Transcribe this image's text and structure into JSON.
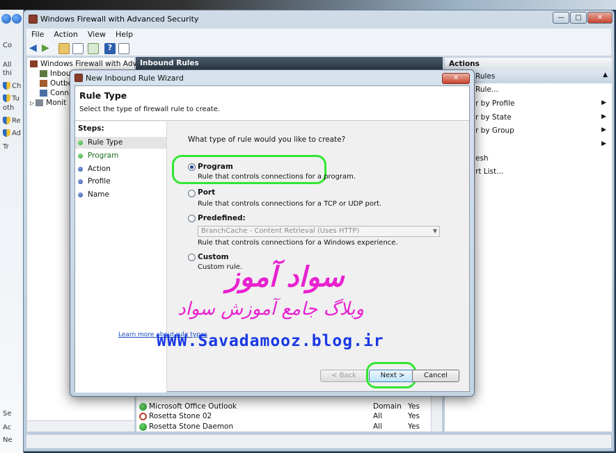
{
  "main_window": {
    "title": "Windows Firewall with Advanced Security",
    "controls": {
      "minimize": "—",
      "maximize": "□",
      "close": "✕"
    }
  },
  "menu": [
    "File",
    "Action",
    "View",
    "Help"
  ],
  "backdrop_left": [
    "Co",
    "All",
    "thi",
    "Ch",
    "Tu",
    "oth",
    "Re",
    "Ad",
    "Tr",
    "Se",
    "Ac",
    "Ne"
  ],
  "tree": {
    "root": "Windows Firewall with Advance",
    "items": [
      "Inboun",
      "Outbo",
      "Conne",
      "Monit"
    ]
  },
  "center": {
    "header": "Inbound Rules",
    "rows": [
      {
        "name": "Microsoft Office Outlook",
        "profile": "Domain",
        "enabled": "Yes",
        "status": "ok"
      },
      {
        "name": "Rosetta Stone 02",
        "profile": "All",
        "enabled": "Yes",
        "status": "no"
      },
      {
        "name": "Rosetta Stone Daemon",
        "profile": "All",
        "enabled": "Yes",
        "status": "ok"
      }
    ]
  },
  "actions": {
    "header": "Actions",
    "section": "Rules",
    "items": [
      {
        "label": "Rule...",
        "arrow": ""
      },
      {
        "label": "r by Profile",
        "arrow": "▶"
      },
      {
        "label": "r by State",
        "arrow": "▶"
      },
      {
        "label": "r by Group",
        "arrow": "▶"
      },
      {
        "label": "",
        "arrow": "▶"
      },
      {
        "label": "esh",
        "arrow": ""
      },
      {
        "label": "rt List...",
        "arrow": ""
      }
    ]
  },
  "wizard": {
    "title": "New Inbound Rule Wizard",
    "close": "✕",
    "heading": "Rule Type",
    "subheading": "Select the type of firewall rule to create.",
    "steps_title": "Steps:",
    "steps": [
      {
        "label": "Rule Type",
        "state": "active"
      },
      {
        "label": "Program",
        "state": "done"
      },
      {
        "label": "Action",
        "state": "pending"
      },
      {
        "label": "Profile",
        "state": "pending"
      },
      {
        "label": "Name",
        "state": "pending"
      }
    ],
    "question": "What type of rule would you like to create?",
    "options": [
      {
        "label": "Program",
        "desc": "Rule that controls connections for a program.",
        "checked": true
      },
      {
        "label": "Port",
        "desc": "Rule that controls connections for a TCP or UDP port.",
        "checked": false
      },
      {
        "label": "Predefined:",
        "desc": "Rule that controls connections for a Windows experience.",
        "checked": false
      },
      {
        "label": "Custom",
        "desc": "Custom rule.",
        "checked": false
      }
    ],
    "predefined_value": "BranchCache - Content Retrieval (Uses HTTP)",
    "learn_more": "Learn more about rule types",
    "buttons": {
      "back": "< Back",
      "next": "Next >",
      "cancel": "Cancel"
    }
  },
  "watermark": {
    "line1": "سواد آموز",
    "line2": "وبلاگ جامع آموزش سواد",
    "line3": "WWW.Savadamooz.blog.ir"
  },
  "colors": {
    "highlight": "#32e632",
    "watermark_pink": "#e821d0",
    "watermark_blue": "#1838e6"
  }
}
